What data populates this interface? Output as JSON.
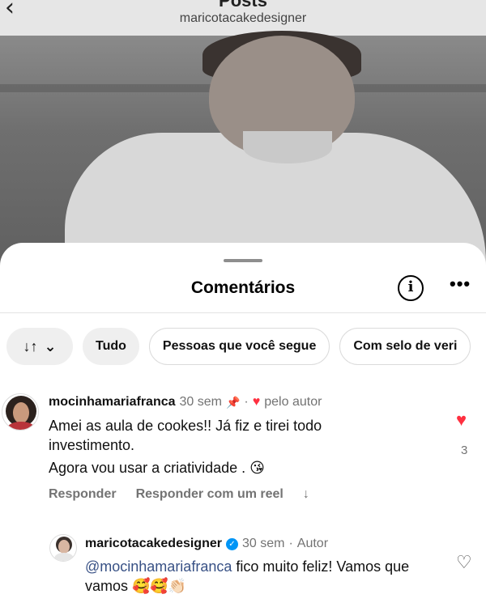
{
  "header": {
    "back_icon": "chevron-left-icon",
    "title": "Posts",
    "subtitle": "maricotacakedesigner"
  },
  "sheet": {
    "title": "Comentários",
    "info_icon": "info-icon",
    "more_icon": "more-horizontal-icon",
    "more_glyph": "•••"
  },
  "filters": {
    "sort_icon": "sort-arrows-icon",
    "sort_glyph": "↓↑",
    "sort_chevron": "⌄",
    "items": [
      "Tudo",
      "Pessoas que você segue",
      "Com selo de veri"
    ]
  },
  "comments": [
    {
      "username": "mocinhamariafranca",
      "time": "30 sem",
      "pinned_icon": "pin-icon",
      "separator": "·",
      "liked_by_author_label": "pelo autor",
      "lines": [
        "Amei as aula de cookes!! Já fiz e tirei todo investimento."
      ],
      "line2": "Agora vou usar a criatividade . 😘",
      "reply_label": "Responder",
      "reel_reply_label": "Responder com um reel",
      "translate_icon": "↓",
      "like_count": "3",
      "liked": true
    },
    {
      "username": "maricotacakedesigner",
      "time": "30 sem",
      "separator": "·",
      "author_label": "Autor",
      "mention": "@mocinhamariafranca",
      "text": " fico muito feliz! Vamos que vamos 🥰🥰👏🏻",
      "liked": false
    }
  ],
  "colors": {
    "like_red": "#ff3040",
    "verified_blue": "#0095f6",
    "mention": "#385185",
    "secondary_text": "#737373"
  }
}
